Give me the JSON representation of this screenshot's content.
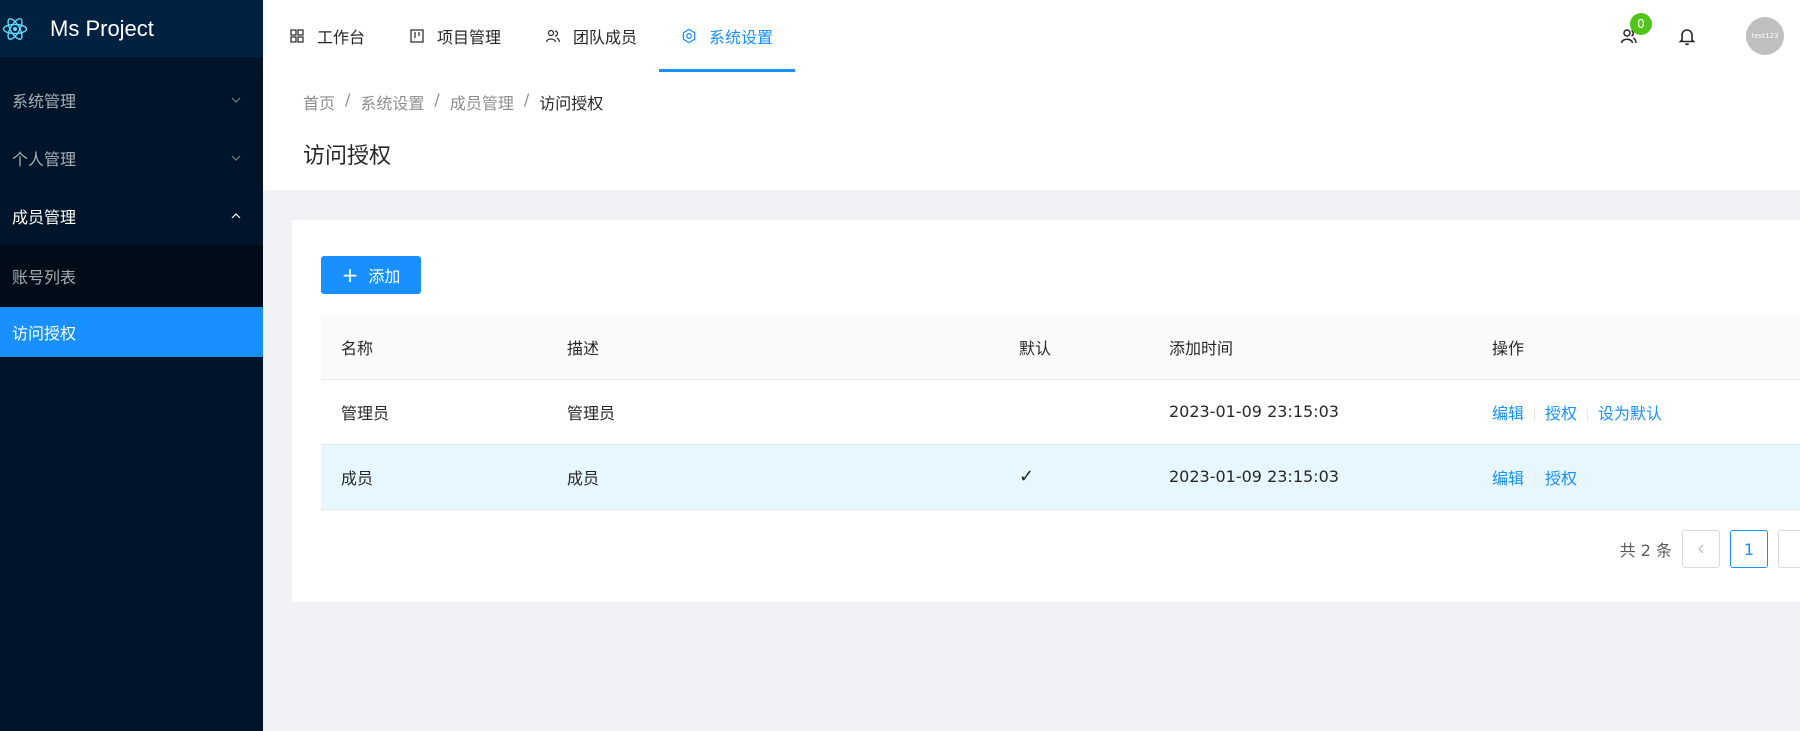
{
  "brand": {
    "name": "Ms Project"
  },
  "sidebar": {
    "groups": [
      {
        "label": "系统管理",
        "expanded": false
      },
      {
        "label": "个人管理",
        "expanded": false
      },
      {
        "label": "成员管理",
        "expanded": true
      }
    ],
    "sub_items": [
      {
        "label": "账号列表",
        "active": false
      },
      {
        "label": "访问授权",
        "active": true
      }
    ]
  },
  "topnav": {
    "items": [
      {
        "label": "工作台",
        "icon": "grid-icon"
      },
      {
        "label": "项目管理",
        "icon": "board-icon"
      },
      {
        "label": "团队成员",
        "icon": "team-icon"
      },
      {
        "label": "系统设置",
        "icon": "settings-icon",
        "active": true
      }
    ],
    "badge_count": "0",
    "avatar_text": "test123"
  },
  "breadcrumb": [
    "首页",
    "系统设置",
    "成员管理",
    "访问授权"
  ],
  "breadcrumb_sep": "/",
  "page": {
    "title": "访问授权"
  },
  "toolbar": {
    "add_label": "添加"
  },
  "table": {
    "headers": [
      "名称",
      "描述",
      "默认",
      "添加时间",
      "操作"
    ],
    "rows": [
      {
        "name": "管理员",
        "desc": "管理员",
        "default": "",
        "time": "2023-01-09 23:15:03",
        "actions": [
          "编辑",
          "授权",
          "设为默认"
        ]
      },
      {
        "name": "成员",
        "desc": "成员",
        "default": "✓",
        "time": "2023-01-09 23:15:03",
        "actions": [
          "编辑",
          "授权"
        ]
      }
    ]
  },
  "pagination": {
    "total_text": "共 2 条",
    "current": "1"
  },
  "colors": {
    "primary": "#1890ff",
    "sidebar_bg": "#001529",
    "badge": "#52c41a"
  }
}
